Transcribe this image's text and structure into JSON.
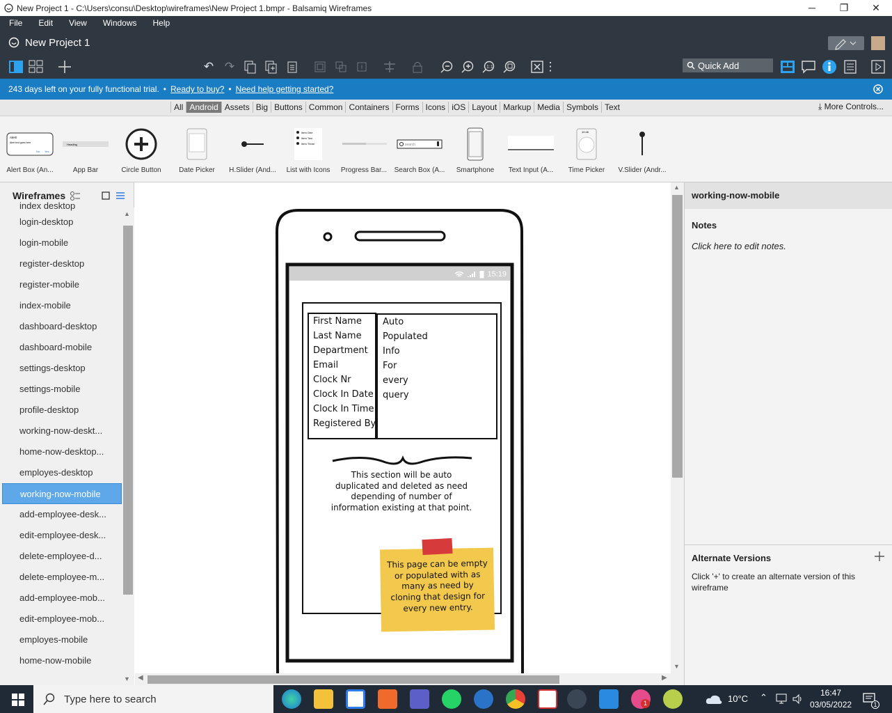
{
  "titlebar": {
    "title": "New Project 1 - C:\\Users\\consu\\Desktop\\wireframes\\New Project 1.bmpr - Balsamiq Wireframes",
    "min": "─",
    "max": "❐",
    "close": "✕"
  },
  "menu": {
    "items": [
      "File",
      "Edit",
      "View",
      "Windows",
      "Help"
    ]
  },
  "project": {
    "name": "New Project 1"
  },
  "toolbar": {
    "quick_add": "Quick Add"
  },
  "trial": {
    "text": "243 days left on your fully functional trial.",
    "sep1": "•",
    "ready": "Ready to buy?",
    "sep2": "•",
    "help": "Need help getting started?"
  },
  "categories": {
    "items": [
      "All",
      "Android",
      "Assets",
      "Big",
      "Buttons",
      "Common",
      "Containers",
      "Forms",
      "Icons",
      "iOS",
      "Layout",
      "Markup",
      "Media",
      "Symbols",
      "Text"
    ],
    "selected": "Android",
    "more": "More Controls..."
  },
  "library": {
    "items": [
      "Alert Box (An...",
      "App Bar",
      "Circle Button",
      "Date Picker",
      "H.Slider (And...",
      "List with Icons",
      "Progress Bar...",
      "Search Box (A...",
      "Smartphone",
      "Text Input (A...",
      "Time Picker",
      "V.Slider (Andr..."
    ]
  },
  "library_thumbs": {
    "alert_title": "Alert!",
    "alert_text": "Alert text goes here",
    "alert_no": "No",
    "alert_yes": "Yes",
    "appbar_text": "Heading",
    "list_items": [
      "Item One",
      "Item Two",
      "Item Three"
    ],
    "search_placeholder": "search",
    "time": "10:46"
  },
  "wireframes": {
    "header": "Wireframes",
    "items": [
      "index desktop",
      "login-desktop",
      "login-mobile",
      "register-desktop",
      "register-mobile",
      "index-mobile",
      "dashboard-desktop",
      "dashboard-mobile",
      "settings-desktop",
      "settings-mobile",
      "profile-desktop",
      "working-now-deskt...",
      "home-now-desktop...",
      "employes-desktop",
      "working-now-mobile",
      "add-employee-desk...",
      "edit-employee-desk...",
      "delete-employee-d...",
      "delete-employee-m...",
      "add-employee-mob...",
      "edit-employee-mob...",
      "employes-mobile",
      "home-now-mobile"
    ],
    "selected": "working-now-mobile"
  },
  "mockup": {
    "status_time": "15:19",
    "labels": [
      "First Name",
      "Last Name",
      "Department",
      "Email",
      "Clock Nr",
      "Clock In Date",
      "Clock In Time",
      "Registered By"
    ],
    "values": [
      "Auto",
      "Populated",
      "Info",
      "For",
      "every",
      "query"
    ],
    "section_note": [
      "This section will be auto",
      "duplicated and deleted as need",
      "depending of number of",
      "information existing at that point."
    ],
    "sticky_note": [
      "This page can be empty",
      "or populated with as",
      "many as need by",
      "cloning that design for",
      "every new entry."
    ]
  },
  "right_panel": {
    "title": "working-now-mobile",
    "notes_heading": "Notes",
    "notes_placeholder": "Click here to edit notes.",
    "alt_heading": "Alternate Versions",
    "alt_desc": "Click '+' to create an alternate version of this wireframe"
  },
  "taskbar": {
    "search_placeholder": "Type here to search",
    "weather": "10°C",
    "time": "16:47",
    "date": "03/05/2022",
    "notif_count": "1",
    "teams_badge": "1"
  },
  "colors": {
    "chrome": "#2f3740",
    "accent": "#1a7dc4",
    "selected": "#5ea7e8",
    "sticky": "#f2c94c"
  }
}
